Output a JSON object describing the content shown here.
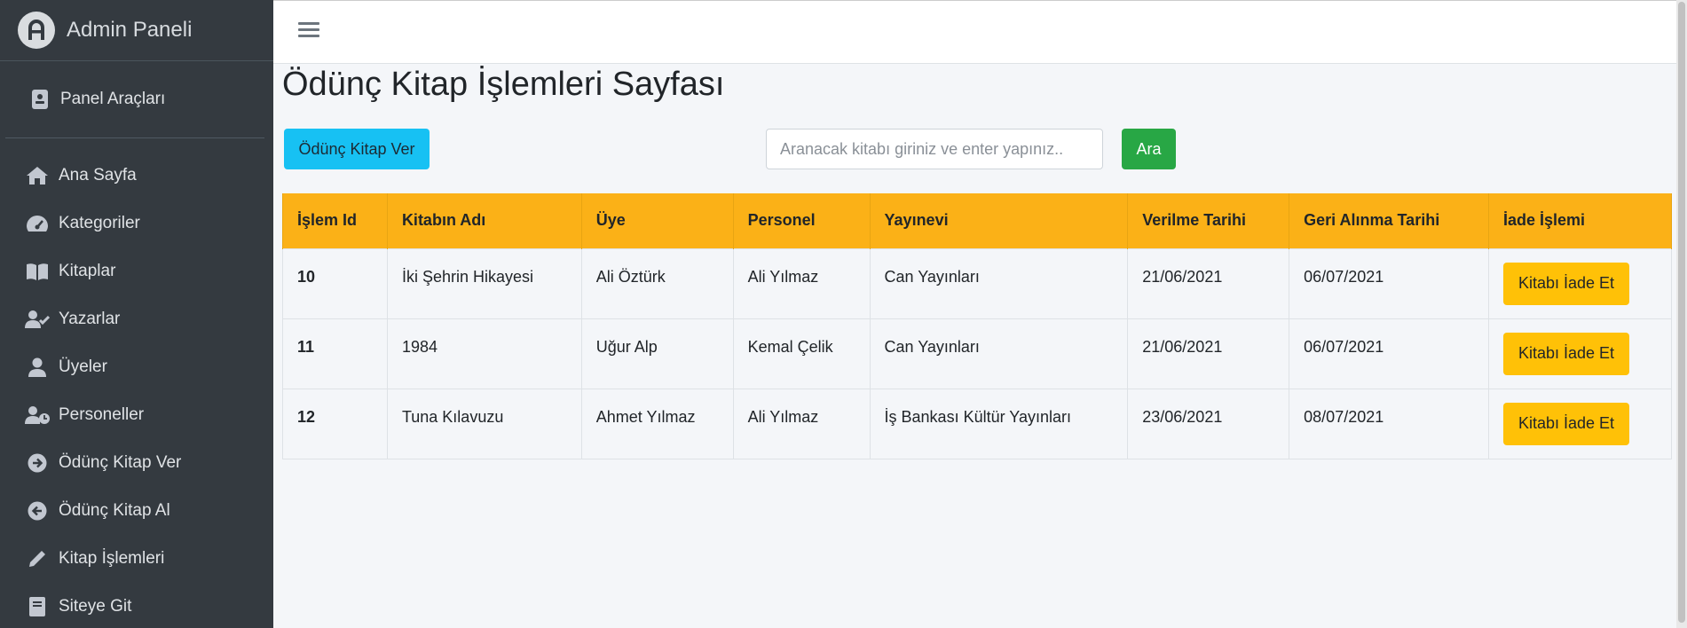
{
  "brand": {
    "title": "Admin Paneli"
  },
  "sidebar": {
    "panel_tools": "Panel Araçları",
    "items": [
      {
        "label": "Ana Sayfa",
        "icon": "home-icon"
      },
      {
        "label": "Kategoriler",
        "icon": "gauge-icon"
      },
      {
        "label": "Kitaplar",
        "icon": "book-open-icon"
      },
      {
        "label": "Yazarlar",
        "icon": "user-check-icon"
      },
      {
        "label": "Üyeler",
        "icon": "user-icon"
      },
      {
        "label": "Personeller",
        "icon": "user-clock-icon"
      },
      {
        "label": "Ödünç Kitap Ver",
        "icon": "arrow-circle-right-icon"
      },
      {
        "label": "Ödünç Kitap Al",
        "icon": "arrow-circle-left-icon"
      },
      {
        "label": "Kitap İşlemleri",
        "icon": "pencil-icon"
      },
      {
        "label": "Siteye Git",
        "icon": "book-icon"
      }
    ]
  },
  "page": {
    "title": "Ödünç Kitap İşlemleri Sayfası",
    "lend_button": "Ödünç Kitap Ver",
    "search_placeholder": "Aranacak kitabı giriniz ve enter yapınız..",
    "search_button": "Ara"
  },
  "table": {
    "headers": [
      "İşlem Id",
      "Kitabın Adı",
      "Üye",
      "Personel",
      "Yayınevi",
      "Verilme Tarihi",
      "Geri Alınma Tarihi",
      "İade İşlemi"
    ],
    "rows": [
      {
        "id": "10",
        "book": "İki Şehrin Hikayesi",
        "member": "Ali Öztürk",
        "staff": "Ali Yılmaz",
        "publisher": "Can Yayınları",
        "given": "21/06/2021",
        "returned": "06/07/2021",
        "action": "Kitabı İade Et"
      },
      {
        "id": "11",
        "book": "1984",
        "member": "Uğur Alp",
        "staff": "Kemal Çelik",
        "publisher": "Can Yayınları",
        "given": "21/06/2021",
        "returned": "06/07/2021",
        "action": "Kitabı İade Et"
      },
      {
        "id": "12",
        "book": "Tuna Kılavuzu",
        "member": "Ahmet Yılmaz",
        "staff": "Ali Yılmaz",
        "publisher": "İş Bankası Kültür Yayınları",
        "given": "23/06/2021",
        "returned": "08/07/2021",
        "action": "Kitabı İade Et"
      }
    ]
  },
  "colors": {
    "sidebar_bg": "#343a40",
    "table_header": "#fbb117",
    "lend_button": "#17c1f3",
    "search_button": "#28a745",
    "return_button": "#ffc107"
  }
}
